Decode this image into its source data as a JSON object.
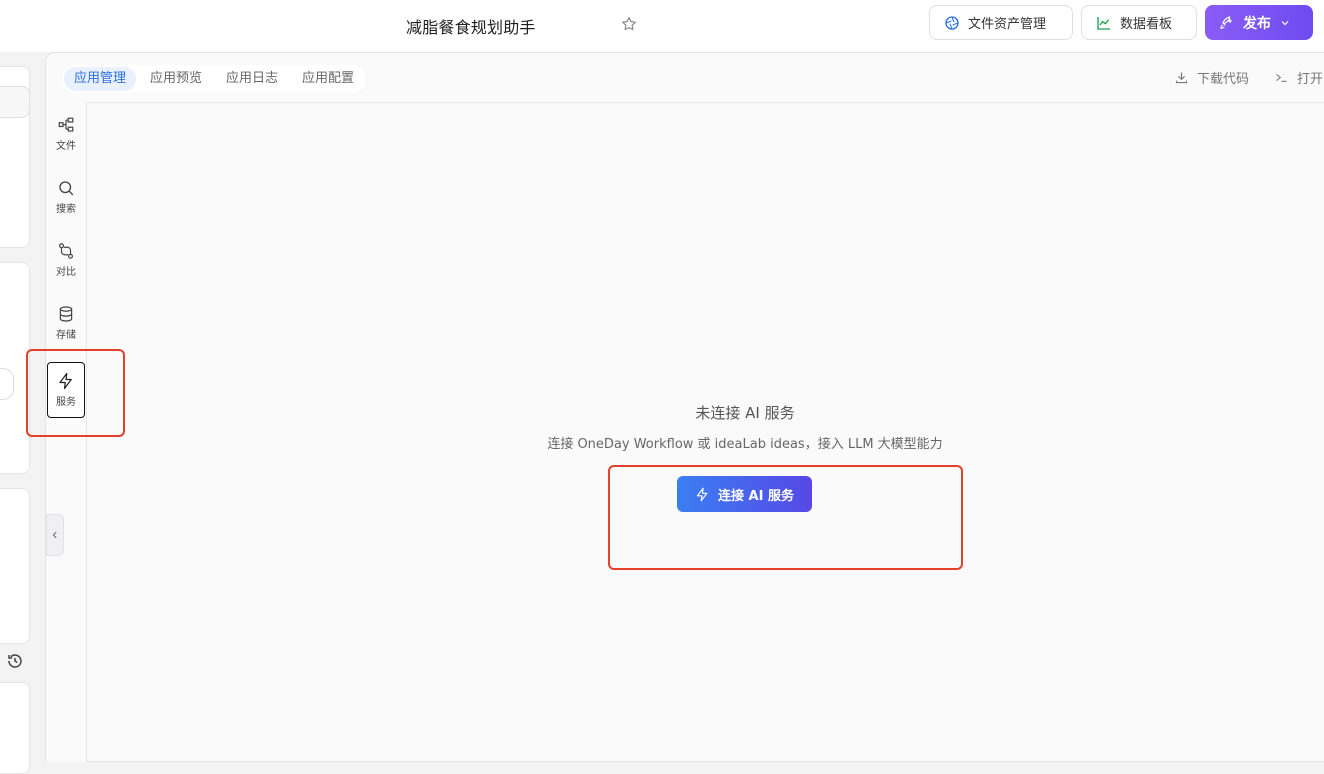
{
  "header": {
    "title": "减脂餐食规划助手",
    "buttons": {
      "assets": "文件资产管理",
      "dashboard": "数据看板",
      "publish": "发布"
    },
    "colors": {
      "publish": "#7c55f3",
      "assets_icon": "#2b6de0",
      "dashboard_icon": "#1f9d55"
    }
  },
  "tabs": [
    "应用管理",
    "应用预览",
    "应用日志",
    "应用配置"
  ],
  "active_tab": "应用管理",
  "toolbar_right": {
    "download": "下载代码",
    "open": "打开"
  },
  "sidebar": {
    "items": [
      {
        "label": "文件",
        "icon": "file-tree-icon"
      },
      {
        "label": "搜索",
        "icon": "search-icon"
      },
      {
        "label": "对比",
        "icon": "diff-icon"
      },
      {
        "label": "存储",
        "icon": "database-icon"
      },
      {
        "label": "服务",
        "icon": "lightning-icon"
      }
    ],
    "active": "服务"
  },
  "empty_state": {
    "title": "未连接 AI 服务",
    "description": "连接 OneDay Workflow 或 ideaLab ideas，接入 LLM 大模型能力",
    "button": "连接 AI 服务"
  },
  "annotation_color": "#e4402b"
}
